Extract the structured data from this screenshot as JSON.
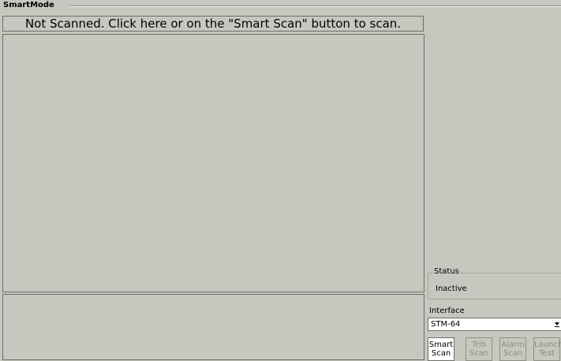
{
  "group_title": "SmartMode",
  "banner_text": "Not Scanned.  Click here or on the \"Smart Scan\" button to scan.",
  "status": {
    "title": "Status",
    "value": "Inactive"
  },
  "interface": {
    "label": "Interface",
    "value": "STM-64"
  },
  "buttons": [
    {
      "line1": "Smart",
      "line2": "Scan",
      "enabled": true
    },
    {
      "line1": "Trib",
      "line2": "Scan",
      "enabled": false
    },
    {
      "line1": "Alarm",
      "line2": "Scan",
      "enabled": false
    },
    {
      "line1": "Launch",
      "line2": "Test",
      "enabled": false
    }
  ]
}
